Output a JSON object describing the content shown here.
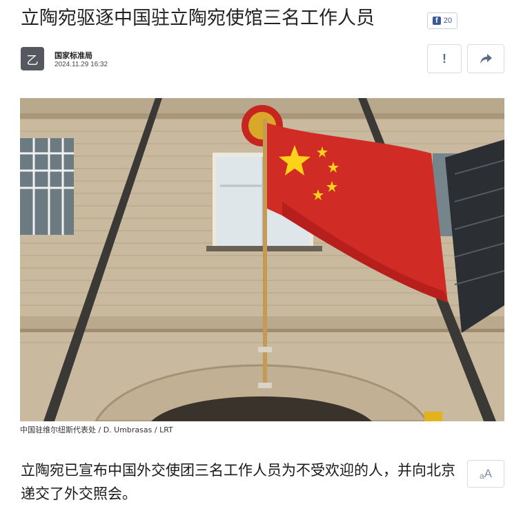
{
  "article": {
    "title": "立陶宛驱逐中国驻立陶宛使馆三名工作人员",
    "facebook_share": {
      "icon": "f",
      "count": "20"
    },
    "author": {
      "avatar_letter": "乙",
      "name": "国家标准局",
      "date": "2024.11.29 16:32"
    },
    "actions": {
      "report_icon": "!",
      "share_icon": "share-arrow-icon"
    },
    "photo": {
      "caption": "中国驻维尔纽斯代表处 / D. Umbrasas / LRT"
    },
    "lead": "立陶宛已宣布中国外交使团三名工作人员为不受欢迎的人，并向北京递交了外交照会。",
    "font_size_control": {
      "small": "a",
      "large": "A"
    }
  },
  "colors": {
    "facebook_blue": "#3b5998",
    "flag_red": "#d12b26",
    "flag_star_yellow": "#ffd21a",
    "avatar_gray": "#55595f",
    "button_border": "#d6dbe3"
  }
}
